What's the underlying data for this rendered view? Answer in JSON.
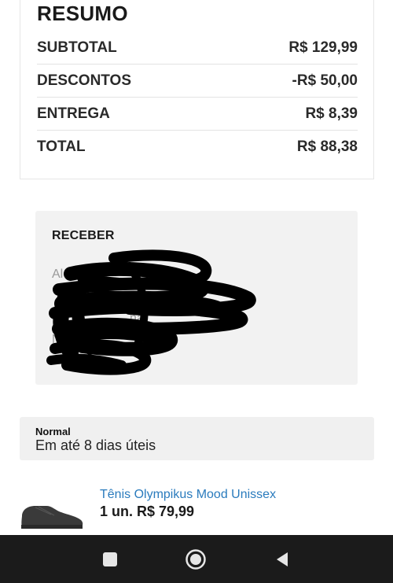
{
  "summary": {
    "title": "RESUMO",
    "rows": [
      {
        "label": "SUBTOTAL",
        "value": "R$ 129,99"
      },
      {
        "label": "DESCONTOS",
        "value": "-R$ 50,00"
      },
      {
        "label": "ENTREGA",
        "value": "R$ 8,39"
      },
      {
        "label": "TOTAL",
        "value": "R$ 88,38"
      }
    ]
  },
  "receive": {
    "title": "RECEBER",
    "address_lines": [
      "Al",
      "na",
      "Na"
    ]
  },
  "shipping": {
    "type": "Normal",
    "estimate": "Em até 8 dias úteis"
  },
  "product": {
    "name": "Tênis Olympikus Mood Unissex",
    "quantity_price": "1 un. R$ 79,99",
    "thumbnail_icon": "sneaker-icon"
  },
  "navigation": {
    "recents_icon": "square-icon",
    "home_icon": "circle-home-icon",
    "back_icon": "triangle-back-icon"
  },
  "colors": {
    "link": "#2a7bbd",
    "nav_bar": "#1b1b1b",
    "panel_bg": "#f2f2f2"
  }
}
